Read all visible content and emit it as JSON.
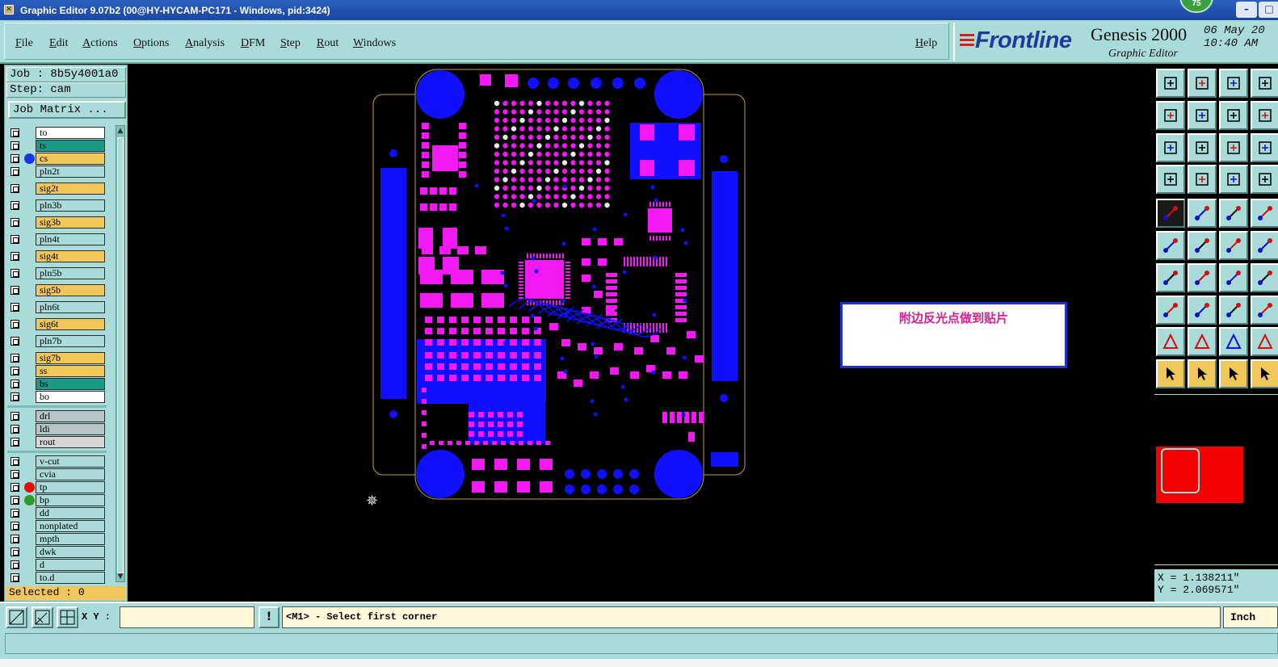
{
  "window": {
    "title": "Graphic Editor 9.07b2 (00@HY-HYCAM-PC171 - Windows, pid:3424)",
    "badge": "75"
  },
  "menu": {
    "items": [
      "File",
      "Edit",
      "Actions",
      "Options",
      "Analysis",
      "DFM",
      "Step",
      "Rout",
      "Windows"
    ],
    "help": "Help"
  },
  "brand": {
    "logo": "Frontline",
    "product": "Genesis 2000",
    "subtitle": "Graphic Editor",
    "date": "06 May 20",
    "time": "10:40 AM"
  },
  "job": {
    "job_label": "Job : 8b5y4001a0",
    "step_label": "Step: cam",
    "matrix_button": "Job Matrix ..."
  },
  "layers": [
    {
      "name": "to",
      "color": "#ffffff",
      "dot": ""
    },
    {
      "name": "ts",
      "color": "#1a9a86",
      "dot": ""
    },
    {
      "name": "cs",
      "color": "#f1c75c",
      "dot": "#1538e0"
    },
    {
      "name": "pln2t",
      "color": "#a9dcd8",
      "dot": ""
    },
    {
      "name": "sig2t",
      "color": "#f1c75c",
      "dot": ""
    },
    {
      "name": "pln3b",
      "color": "#a9dcd8",
      "dot": ""
    },
    {
      "name": "sig3b",
      "color": "#f1c75c",
      "dot": ""
    },
    {
      "name": "pln4t",
      "color": "#a9dcd8",
      "dot": ""
    },
    {
      "name": "sig4t",
      "color": "#f1c75c",
      "dot": ""
    },
    {
      "name": "pln5b",
      "color": "#a9dcd8",
      "dot": ""
    },
    {
      "name": "sig5b",
      "color": "#f1c75c",
      "dot": ""
    },
    {
      "name": "pln6t",
      "color": "#a9dcd8",
      "dot": ""
    },
    {
      "name": "sig6t",
      "color": "#f1c75c",
      "dot": ""
    },
    {
      "name": "pln7b",
      "color": "#a9dcd8",
      "dot": ""
    },
    {
      "name": "sig7b",
      "color": "#f1c75c",
      "dot": ""
    },
    {
      "name": "ss",
      "color": "#f1c75c",
      "dot": ""
    },
    {
      "name": "bs",
      "color": "#1a9a86",
      "dot": ""
    },
    {
      "name": "bo",
      "color": "#ffffff",
      "dot": ""
    },
    {
      "name": "drl",
      "color": "#b7c4c6",
      "dot": ""
    },
    {
      "name": "ldi",
      "color": "#b7c4c6",
      "dot": ""
    },
    {
      "name": "rout",
      "color": "#d6d6d6",
      "dot": ""
    },
    {
      "name": "v-cut",
      "color": "#a9dcd8",
      "dot": ""
    },
    {
      "name": "cvia",
      "color": "#a9dcd8",
      "dot": ""
    },
    {
      "name": "tp",
      "color": "#a9dcd8",
      "dot": "#e01010"
    },
    {
      "name": "bp",
      "color": "#a9dcd8",
      "dot": "#2e9a2e"
    },
    {
      "name": "dd",
      "color": "#a9dcd8",
      "dot": ""
    },
    {
      "name": "nonplated",
      "color": "#a9dcd8",
      "dot": ""
    },
    {
      "name": "mpth",
      "color": "#a9dcd8",
      "dot": ""
    },
    {
      "name": "dwk",
      "color": "#a9dcd8",
      "dot": ""
    },
    {
      "name": "d",
      "color": "#a9dcd8",
      "dot": ""
    },
    {
      "name": "to.d",
      "color": "#a9dcd8",
      "dot": ""
    }
  ],
  "selected_label": "Selected : 0",
  "canvas": {
    "note": "附边反光点做到贴片",
    "board_colors": {
      "pad": "#f219f5",
      "copper": "#1010ff",
      "outline": "#c0a040"
    }
  },
  "coords": {
    "x": "X = 1.138211\"",
    "y": "Y = 2.069571\""
  },
  "command": {
    "xy_label": "X Y :",
    "xy_value": "",
    "prompt": "<M1> - Select first corner",
    "units": "Inch"
  }
}
